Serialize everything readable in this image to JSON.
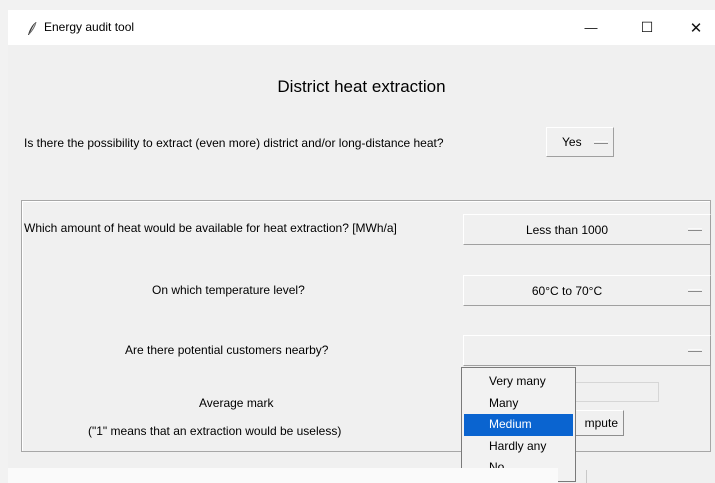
{
  "window": {
    "title": "Energy audit tool",
    "controls": {
      "minimize": "—",
      "maximize": "☐",
      "close": "✕"
    }
  },
  "heading": "District heat extraction",
  "question_extract": {
    "label": "Is there the possibility to extract (even more) district and/or long-distance heat?",
    "value": "Yes"
  },
  "frame": {
    "amount": {
      "label": "Which amount of heat would be available for heat extraction? [MWh/a]",
      "value": "Less than 1000"
    },
    "temperature": {
      "label": "On which temperature level?",
      "value": "60°C to 70°C"
    },
    "customers": {
      "label": "Are there potential customers nearby?",
      "value": ""
    },
    "average": {
      "label": "Average mark",
      "note": "(\"1\" means that an extraction would be useless)",
      "value": ""
    },
    "compute_button": "mpute"
  },
  "dropdown": {
    "options": [
      "Very many",
      "Many",
      "Medium",
      "Hardly any",
      "No"
    ],
    "selected": "Medium"
  },
  "colors": {
    "selection": "#0a64d0",
    "window_bg": "#f0f0f0",
    "titlebar_bg": "#ffffff"
  }
}
